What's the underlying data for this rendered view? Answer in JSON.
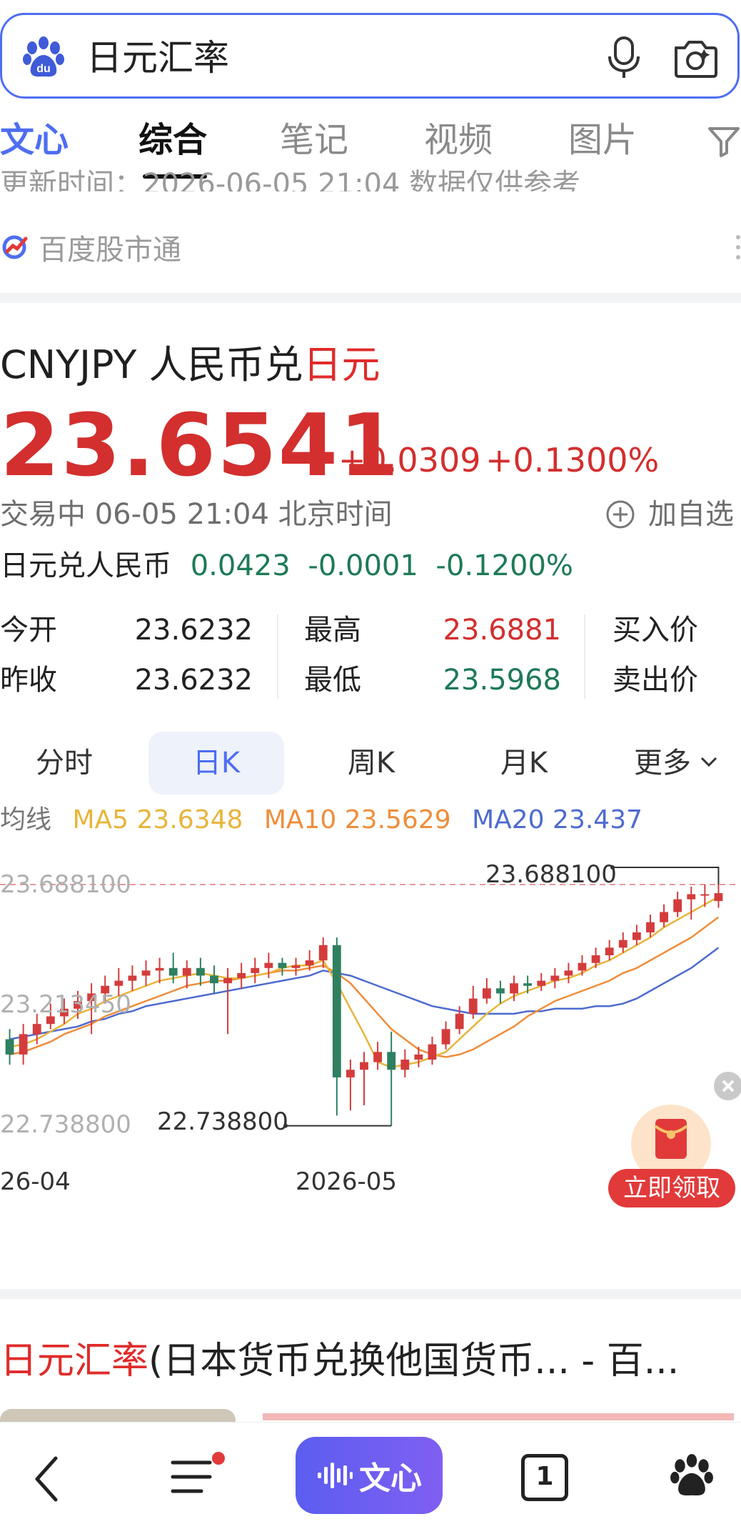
{
  "search": {
    "query": "日元汇率"
  },
  "tabs": [
    {
      "label": "文心"
    },
    {
      "label": "综合"
    },
    {
      "label": "笔记"
    },
    {
      "label": "视频"
    },
    {
      "label": "图片"
    }
  ],
  "prev_card": {
    "update_text": "更新时间：2026-06-05 21:04 数据仅供参考",
    "source": "百度股市通"
  },
  "quote": {
    "pair": "CNYJPY 人民币兑",
    "pair_highlight": "日元",
    "price": "23.6541",
    "change": "+0.0309",
    "change_pct": "+0.1300%",
    "status": "交易中 06-05 21:04 北京时间",
    "add_watch": "加自选",
    "inverse_label": "日元兑人民币",
    "inverse_price": "0.0423",
    "inverse_change": "-0.0001",
    "inverse_pct": "-0.1200%",
    "stats": {
      "open_label": "今开",
      "open": "23.6232",
      "prev_label": "昨收",
      "prev": "23.6232",
      "high_label": "最高",
      "high": "23.6881",
      "low_label": "最低",
      "low": "23.5968",
      "bid_label": "买入价",
      "ask_label": "卖出价"
    }
  },
  "chart_tabs": [
    {
      "label": "分时"
    },
    {
      "label": "日K"
    },
    {
      "label": "周K"
    },
    {
      "label": "月K"
    },
    {
      "label": "更多"
    }
  ],
  "ma": {
    "label": "均线",
    "ma5": "MA5 23.6348",
    "ma10": "MA10 23.5629",
    "ma20": "MA20 23.437",
    "colors": {
      "ma5": "#e8b43a",
      "ma10": "#ef8d3a",
      "ma20": "#4e6bcf"
    }
  },
  "chart": {
    "y_top_label": "23.688100",
    "y_mid_label": "23.213450",
    "y_bot_label": "22.738800",
    "max_annotation": "23.688100",
    "min_annotation": "22.738800",
    "x_labels": [
      "26-04",
      "2026-05"
    ],
    "up_color": "#d43c3c",
    "down_color": "#2e8060"
  },
  "chart_data": {
    "type": "candlestick",
    "ylim": [
      22.7388,
      23.6881
    ],
    "candles": [
      {
        "o": 23.08,
        "c": 23.02,
        "h": 23.12,
        "l": 22.98
      },
      {
        "o": 23.02,
        "c": 23.1,
        "h": 23.14,
        "l": 22.98
      },
      {
        "o": 23.1,
        "c": 23.14,
        "h": 23.18,
        "l": 23.06
      },
      {
        "o": 23.14,
        "c": 23.17,
        "h": 23.22,
        "l": 23.12
      },
      {
        "o": 23.17,
        "c": 23.2,
        "h": 23.24,
        "l": 23.14
      },
      {
        "o": 23.2,
        "c": 23.23,
        "h": 23.27,
        "l": 23.16
      },
      {
        "o": 23.23,
        "c": 23.26,
        "h": 23.3,
        "l": 23.1
      },
      {
        "o": 23.26,
        "c": 23.29,
        "h": 23.33,
        "l": 23.22
      },
      {
        "o": 23.29,
        "c": 23.31,
        "h": 23.36,
        "l": 23.25
      },
      {
        "o": 23.31,
        "c": 23.33,
        "h": 23.37,
        "l": 23.27
      },
      {
        "o": 23.33,
        "c": 23.35,
        "h": 23.39,
        "l": 23.29
      },
      {
        "o": 23.35,
        "c": 23.36,
        "h": 23.4,
        "l": 23.3
      },
      {
        "o": 23.36,
        "c": 23.33,
        "h": 23.42,
        "l": 23.3
      },
      {
        "o": 23.33,
        "c": 23.36,
        "h": 23.39,
        "l": 23.28
      },
      {
        "o": 23.36,
        "c": 23.33,
        "h": 23.4,
        "l": 23.29
      },
      {
        "o": 23.33,
        "c": 23.3,
        "h": 23.37,
        "l": 23.26
      },
      {
        "o": 23.3,
        "c": 23.32,
        "h": 23.36,
        "l": 23.1
      },
      {
        "o": 23.32,
        "c": 23.34,
        "h": 23.38,
        "l": 23.28
      },
      {
        "o": 23.34,
        "c": 23.36,
        "h": 23.4,
        "l": 23.3
      },
      {
        "o": 23.36,
        "c": 23.38,
        "h": 23.42,
        "l": 23.32
      },
      {
        "o": 23.38,
        "c": 23.36,
        "h": 23.4,
        "l": 23.33
      },
      {
        "o": 23.36,
        "c": 23.37,
        "h": 23.4,
        "l": 23.33
      },
      {
        "o": 23.37,
        "c": 23.39,
        "h": 23.43,
        "l": 23.35
      },
      {
        "o": 23.39,
        "c": 23.45,
        "h": 23.48,
        "l": 23.36
      },
      {
        "o": 23.45,
        "c": 22.93,
        "h": 23.48,
        "l": 22.78
      },
      {
        "o": 22.93,
        "c": 22.96,
        "h": 23.0,
        "l": 22.8
      },
      {
        "o": 22.96,
        "c": 22.99,
        "h": 23.03,
        "l": 22.82
      },
      {
        "o": 22.99,
        "c": 23.03,
        "h": 23.07,
        "l": 22.96
      },
      {
        "o": 23.03,
        "c": 22.96,
        "h": 23.11,
        "l": 22.74
      },
      {
        "o": 22.96,
        "c": 23.0,
        "h": 23.04,
        "l": 22.93
      },
      {
        "o": 23.0,
        "c": 23.02,
        "h": 23.05,
        "l": 22.97
      },
      {
        "o": 23.0,
        "c": 23.06,
        "h": 23.09,
        "l": 22.98
      },
      {
        "o": 23.06,
        "c": 23.12,
        "h": 23.15,
        "l": 23.04
      },
      {
        "o": 23.12,
        "c": 23.18,
        "h": 23.21,
        "l": 23.1
      },
      {
        "o": 23.18,
        "c": 23.24,
        "h": 23.29,
        "l": 23.16
      },
      {
        "o": 23.24,
        "c": 23.28,
        "h": 23.32,
        "l": 23.22
      },
      {
        "o": 23.28,
        "c": 23.26,
        "h": 23.31,
        "l": 23.22
      },
      {
        "o": 23.26,
        "c": 23.3,
        "h": 23.33,
        "l": 23.23
      },
      {
        "o": 23.3,
        "c": 23.29,
        "h": 23.33,
        "l": 23.26
      },
      {
        "o": 23.29,
        "c": 23.31,
        "h": 23.34,
        "l": 23.27
      },
      {
        "o": 23.31,
        "c": 23.33,
        "h": 23.36,
        "l": 23.28
      },
      {
        "o": 23.33,
        "c": 23.35,
        "h": 23.38,
        "l": 23.3
      },
      {
        "o": 23.35,
        "c": 23.38,
        "h": 23.41,
        "l": 23.33
      },
      {
        "o": 23.38,
        "c": 23.41,
        "h": 23.44,
        "l": 23.36
      },
      {
        "o": 23.41,
        "c": 23.44,
        "h": 23.47,
        "l": 23.39
      },
      {
        "o": 23.44,
        "c": 23.47,
        "h": 23.5,
        "l": 23.42
      },
      {
        "o": 23.47,
        "c": 23.5,
        "h": 23.53,
        "l": 23.45
      },
      {
        "o": 23.5,
        "c": 23.54,
        "h": 23.57,
        "l": 23.48
      },
      {
        "o": 23.54,
        "c": 23.58,
        "h": 23.61,
        "l": 23.52
      },
      {
        "o": 23.58,
        "c": 23.63,
        "h": 23.66,
        "l": 23.56
      },
      {
        "o": 23.63,
        "c": 23.65,
        "h": 23.68,
        "l": 23.55
      },
      {
        "o": 23.65,
        "c": 23.65,
        "h": 23.688,
        "l": 23.6
      },
      {
        "o": 23.6232,
        "c": 23.6541,
        "h": 23.6881,
        "l": 23.5968
      }
    ],
    "ma5": [
      23.05,
      23.06,
      23.08,
      23.11,
      23.14,
      23.18,
      23.2,
      23.23,
      23.25,
      23.27,
      23.29,
      23.31,
      23.32,
      23.33,
      23.34,
      23.33,
      23.32,
      23.32,
      23.33,
      23.34,
      23.36,
      23.37,
      23.37,
      23.39,
      23.3,
      23.2,
      23.1,
      22.99,
      22.97,
      22.98,
      22.99,
      23.01,
      23.03,
      23.08,
      23.13,
      23.18,
      23.22,
      23.25,
      23.27,
      23.29,
      23.31,
      23.32,
      23.34,
      23.37,
      23.39,
      23.42,
      23.45,
      23.48,
      23.52,
      23.55,
      23.58,
      23.61,
      23.64
    ],
    "ma10": [
      23.02,
      23.03,
      23.05,
      23.07,
      23.1,
      23.12,
      23.14,
      23.17,
      23.19,
      23.21,
      23.23,
      23.25,
      23.27,
      23.29,
      23.3,
      23.31,
      23.31,
      23.32,
      23.33,
      23.34,
      23.35,
      23.35,
      23.36,
      23.37,
      23.34,
      23.3,
      23.24,
      23.18,
      23.12,
      23.08,
      23.04,
      23.02,
      23.01,
      23.02,
      23.04,
      23.07,
      23.1,
      23.13,
      23.17,
      23.2,
      23.23,
      23.25,
      23.27,
      23.29,
      23.31,
      23.34,
      23.36,
      23.39,
      23.42,
      23.45,
      23.48,
      23.52,
      23.56
    ],
    "ma20": [
      23.08,
      23.09,
      23.1,
      23.11,
      23.12,
      23.13,
      23.15,
      23.16,
      23.18,
      23.19,
      23.21,
      23.22,
      23.23,
      23.24,
      23.25,
      23.26,
      23.27,
      23.28,
      23.29,
      23.3,
      23.31,
      23.32,
      23.33,
      23.35,
      23.34,
      23.33,
      23.31,
      23.29,
      23.27,
      23.25,
      23.23,
      23.21,
      23.2,
      23.19,
      23.18,
      23.18,
      23.18,
      23.18,
      23.19,
      23.19,
      23.2,
      23.2,
      23.2,
      23.21,
      23.21,
      23.22,
      23.24,
      23.27,
      23.3,
      23.33,
      23.36,
      23.4,
      23.44
    ]
  },
  "promo": {
    "label": "立即领取"
  },
  "result": {
    "title_highlight": "日元汇率",
    "title_rest": "(日本货币兑换他国货币... - 百..."
  },
  "bottom_nav": {
    "wenxin": "文心",
    "tab_count": "1"
  }
}
